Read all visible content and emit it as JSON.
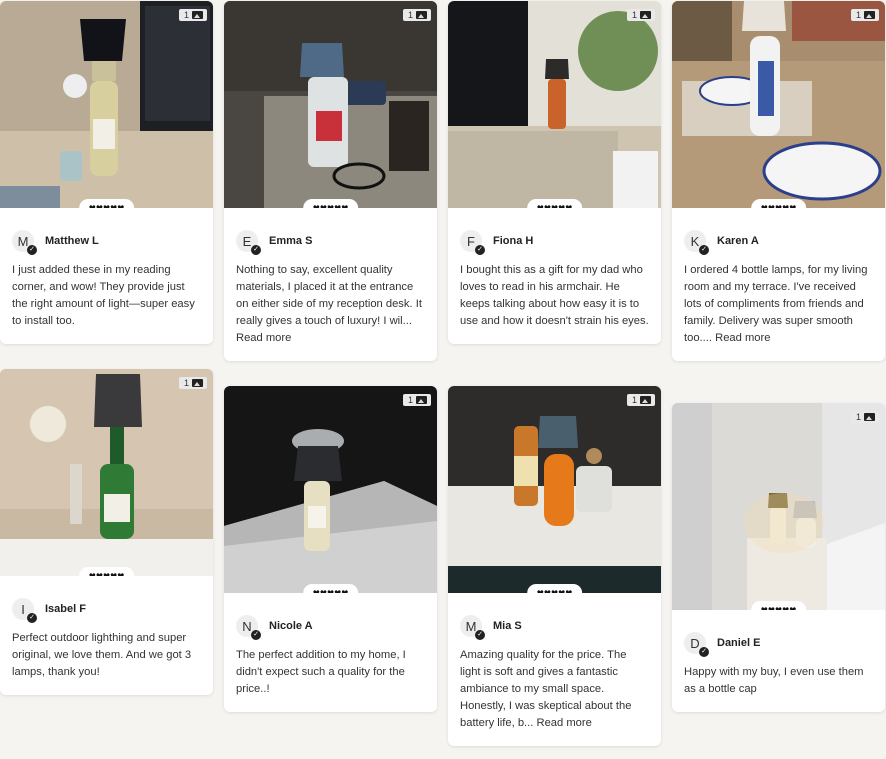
{
  "reviews": [
    {
      "name": "Matthew L",
      "initial": "M",
      "rating": "♥♥♥♥♥",
      "media_count": "1",
      "text": "I just added these in my reading corner, and wow! They provide just the right amount of light—super easy to install too.",
      "read_more": ""
    },
    {
      "name": "Emma S",
      "initial": "E",
      "rating": "♥♥♥♥♥",
      "media_count": "1",
      "text": "Nothing to say, excellent quality materials, I placed it at the entrance on either side of my reception desk. It really gives a touch of luxury! I wil...",
      "read_more": "Read more"
    },
    {
      "name": "Fiona H",
      "initial": "F",
      "rating": "♥♥♥♥♥",
      "media_count": "1",
      "text": "I bought this as a gift for my dad who loves to read in his armchair. He keeps talking about how easy it is to use and how it doesn't strain his eyes.",
      "read_more": ""
    },
    {
      "name": "Karen A",
      "initial": "K",
      "rating": "♥♥♥♥♥",
      "media_count": "1",
      "text": "I ordered 4 bottle lamps, for my living room and my terrace. I've received lots of compliments from friends and family. Delivery was super smooth too....",
      "read_more": "Read more"
    },
    {
      "name": "Isabel F",
      "initial": "I",
      "rating": "♥♥♥♥♥",
      "media_count": "1",
      "text": "Perfect outdoor lighthing and super original, we love them. And we got 3 lamps, thank you!",
      "read_more": ""
    },
    {
      "name": "Nicole A",
      "initial": "N",
      "rating": "♥♥♥♥♥",
      "media_count": "1",
      "text": "The perfect addition to my home, I didn't expect such a quality for the price..!",
      "read_more": ""
    },
    {
      "name": "Mia S",
      "initial": "M",
      "rating": "♥♥♥♥♥",
      "media_count": "1",
      "text": "Amazing quality for the price. The light is soft and gives a fantastic ambiance to my small space. Honestly, I was skeptical about the battery life, b...",
      "read_more": "Read more"
    },
    {
      "name": "Daniel E",
      "initial": "D",
      "rating": "♥♥♥♥♥",
      "media_count": "1",
      "text": "Happy with my buy, I even use them as a bottle cap",
      "read_more": ""
    }
  ],
  "icons": {
    "media": "image-icon",
    "verified": "verified-check-icon",
    "rating": "heart-icon"
  },
  "colors": {
    "background": "#f6f4f1",
    "card": "#ffffff",
    "text": "#333333"
  }
}
